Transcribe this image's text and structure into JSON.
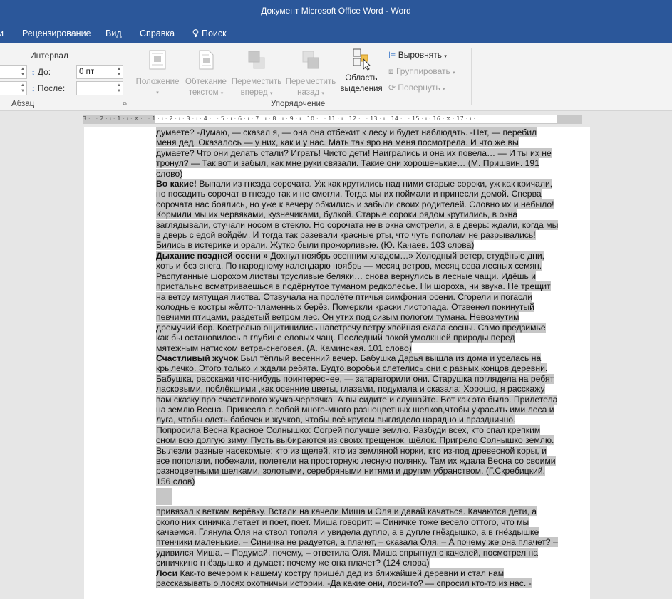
{
  "window": {
    "title": "Документ Microsoft Office Word  -  Word"
  },
  "tabs": [
    {
      "label": "и"
    },
    {
      "label": "Рецензирование"
    },
    {
      "label": "Вид"
    },
    {
      "label": "Справка"
    },
    {
      "label": "Поиск"
    }
  ],
  "ribbon": {
    "paragraph": {
      "interval_label": "Интервал",
      "before_label": "До:",
      "before_value": "0 пт",
      "after_label": "После:",
      "after_value": "",
      "group_label": "Абзац"
    },
    "arrange": {
      "position_label": "Положение",
      "wrap_label_1": "Обтекание",
      "wrap_label_2": "текстом",
      "forward_label_1": "Переместить",
      "forward_label_2": "вперед",
      "backward_label_1": "Переместить",
      "backward_label_2": "назад",
      "selection_label_1": "Область",
      "selection_label_2": "выделения",
      "align_label": "Выровнять",
      "group_btn_label": "Группировать",
      "rotate_label": "Повернуть",
      "group_label": "Упорядочение"
    }
  },
  "ruler": {
    "marks": "3 · ı · 2 · ı · 1 · ı · ⧖ · ı · 1 · ı · 2 · ı · 3 · ı · 4 · ı · 5 · ı · 6 · ı · 7 · ı · 8 · ı · 9 · ı · 10 · ı · 11 · ı · 12 · ı · 13 · ı · 14 · ı · 15 · ı · 16 · ⧖ · 17 · ı ·"
  },
  "document": {
    "p1": "думаете? -Думаю, — сказал я, — она она отбежит к лесу и будет наблюдать. -Нет, — перебил меня дед. Оказалось — у них, как и у нас. Мать так яро на меня посмотрела. И что же вы думаете? Что они делать стали? Играть! Чисто дети! Наигрались и она их повела… — И ты их не тронул? — Так вот и забыл, как мне руки связали. Такие они хорошенькие… (М. Пришвин. 191 слово)",
    "p2_title": "Во какие!",
    "p2": " Выпали из гнезда сорочата. Уж как крутились над ними старые сороки, уж как кричали, но посадить сорочат в гнездо так и не смогли. Тогда мы их поймали и принесли домой. Сперва сорочата нас боялись, но уже к вечеру обжились и забыли своих родителей. Словно их и небыло! Кормили мы их червяками, кузнечиками, булкой. Старые сороки рядом крутились, в окна заглядывали, стучали носом в стекло. Но сорочата не в окна смотрели, а в дверь: ждали, когда мы в дверь с едой войдём. И тогда так разевали красные рты, что чуть пополам не разрывались! Бились в истерике и орали. Жутко были прожорливые. (Ю. Качаев. 103 слова)",
    "p3_title": "Дыхание поздней осени »",
    "p3": " Дохнул ноябрь осенним хладом…» Холодный ветер, студёные дни, хоть и без снега. По народному календарю ноябрь — месяц ветров, месяц сева лесных семян. Распуганные шорохом листвы трусливые беляки… снова вернулись в лесные чащи. Идёшь и пристально всматриваешься в подёрнутое туманом редколесье. Ни шороха, ни звука. Не трещит на ветру мятущая листва. Отзвучала на пролёте птичья симфония осени. Сгорели и погасли холодные костры жёлто-пламенных берёз. Померкли краски листопада. Отзвенел покинутый певчими птицами, раздетый ветром лес. Он утих под сизым пологом тумана. Невозмутим дремучий бор. Кострелью ощитинились навстречу ветру хвойная скала сосны. Само предзимье как бы остановилось в глубине еловых чащ. Последний покой умолкшей природы перед мятежным натиском ветра-снеговея. (А. Каминская. 101 слово)",
    "p4_title": "Счастливый жучок",
    "p4": " Был тёплый весенний вечер. Бабушка Дарья вышла из дома и уселась на крылечко. Этого только и ждали ребята. Будто воробьи слетелись они с разных концов деревни. Бабушка, расскажи что-нибудь поинтереснее, — затараторили они. Старушка поглядела на ребят ласковыми, поблёкшими ,как осенние цветы, глазами, подумала и сказала: Хорошо, я расскажу вам сказку про счастливого жучка-червячка. А вы сидите и слушайте. Вот как это было. Прилетела на землю Весна. Принесла с собой много-много разноцветных шелков,чтобы украсить ими леса и луга, чтобы одеть бабочек и жучков, чтобы всё кругом выглядело нарядно и празднично. Попросила Весна Красное Солнышко: Согрей получше землю. Разбуди всех, кто спал крепким сном всю долгую зиму. Пусть выбираются из своих трещенок, щёлок. Пригрело Солнышко землю. Вылезли разные насекомые: кто из щелей, кто из земляной норки, кто из-под древесной коры, и все поползли, побежали, полетели на просторную лесную полянку. Там их ждала Весна со своими разноцветными шелками, золотыми, серебряными нитями и другим убранством. (Г.Скребицкий. 156 слов)",
    "p5": "привязал к веткам верёвку. Встали на качели Миша и Оля и давай качаться. Качаются дети, а около них синичка летает и поет, поет. Миша говорит: – Синичке тоже весело оттого, что мы качаемся. Глянула Оля на ствол тополя и увидела дупло, а в дупле гнёздышко, а в гнёздышке птенчики маленькие. – Синичка не радуется, а плачет, – сказала Оля. – А почему же она плачет? – удивился Миша. – Подумай, почему, – ответила Оля. Миша спрыгнул с качелей, посмотрел на синичкино гнёздышко и думает: почему же она плачет? (124 слова)",
    "p6_title": "Лоси",
    "p6": " Как-то вечером к нашему костру пришёл дед из ближайшей деревни и стал нам рассказывать о лосях охотничьи истории. -Да какие они, лоси-то? — спросил кто-то из нас. -"
  }
}
